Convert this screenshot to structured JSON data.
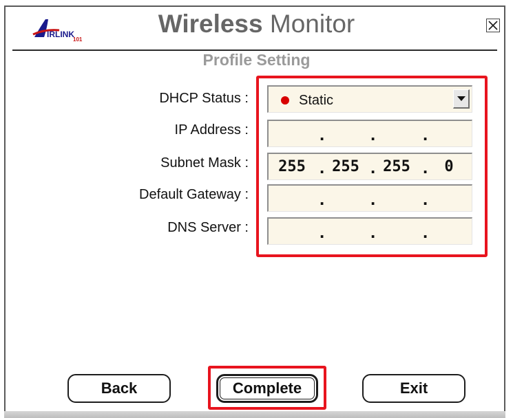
{
  "header": {
    "logo_text": "AIRLINK 101",
    "title_bold": "Wireless",
    "title_light": "Monitor",
    "close_icon": "close-icon"
  },
  "page": {
    "subtitle": "Profile Setting"
  },
  "form": {
    "dhcp_status": {
      "label": "DHCP Status :",
      "selected": "Static",
      "status_color": "#d80000"
    },
    "ip_address": {
      "label": "IP Address :",
      "octets": [
        "",
        "",
        "",
        ""
      ]
    },
    "subnet_mask": {
      "label": "Subnet Mask :",
      "octets": [
        "255",
        "255",
        "255",
        "0"
      ]
    },
    "default_gateway": {
      "label": "Default Gateway :",
      "octets": [
        "",
        "",
        "",
        ""
      ]
    },
    "dns_server": {
      "label": "DNS Server :",
      "octets": [
        "",
        "",
        "",
        ""
      ]
    }
  },
  "buttons": {
    "back": "Back",
    "complete": "Complete",
    "exit": "Exit"
  },
  "colors": {
    "highlight": "#e8141e",
    "field_bg": "#fbf6e8",
    "title_gray": "#666666"
  }
}
